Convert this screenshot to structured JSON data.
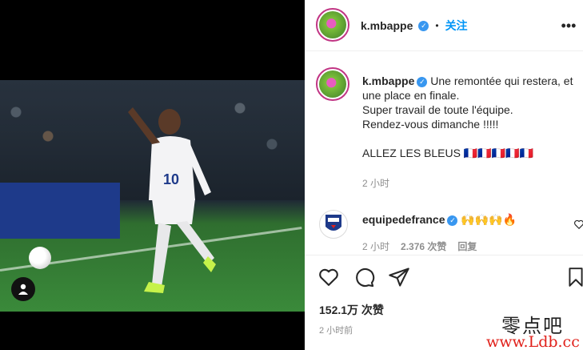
{
  "header": {
    "username": "k.mbappe",
    "separator": "•",
    "follow_label": "关注",
    "more_icon": "more-horizontal-icon"
  },
  "caption": {
    "username": "k.mbappe",
    "text": "Une remontée qui restera, et une place en finale.\nSuper travail de toute l'équipe.\nRendez-vous dimanche !!!!!\n\nALLEZ LES BLEUS 🇫🇷🇫🇷🇫🇷🇫🇷🇫🇷",
    "time": "2 小时"
  },
  "comment": {
    "username": "equipedefrance",
    "text": "🙌🙌🙌🔥",
    "time": "2 小时",
    "likes": "2.376 次赞",
    "reply_label": "回复"
  },
  "actions": {
    "like_icon": "heart-icon",
    "comment_icon": "comment-icon",
    "share_icon": "send-icon",
    "save_icon": "bookmark-icon"
  },
  "stats": {
    "likes": "152.1万 次赞",
    "time": "2 小时前"
  },
  "watermark": {
    "site_cn": "零点吧",
    "url": "www.Ldb.cc"
  },
  "colors": {
    "accent": "#0095f6",
    "verified": "#3897f0",
    "muted": "#8e8e8e"
  }
}
